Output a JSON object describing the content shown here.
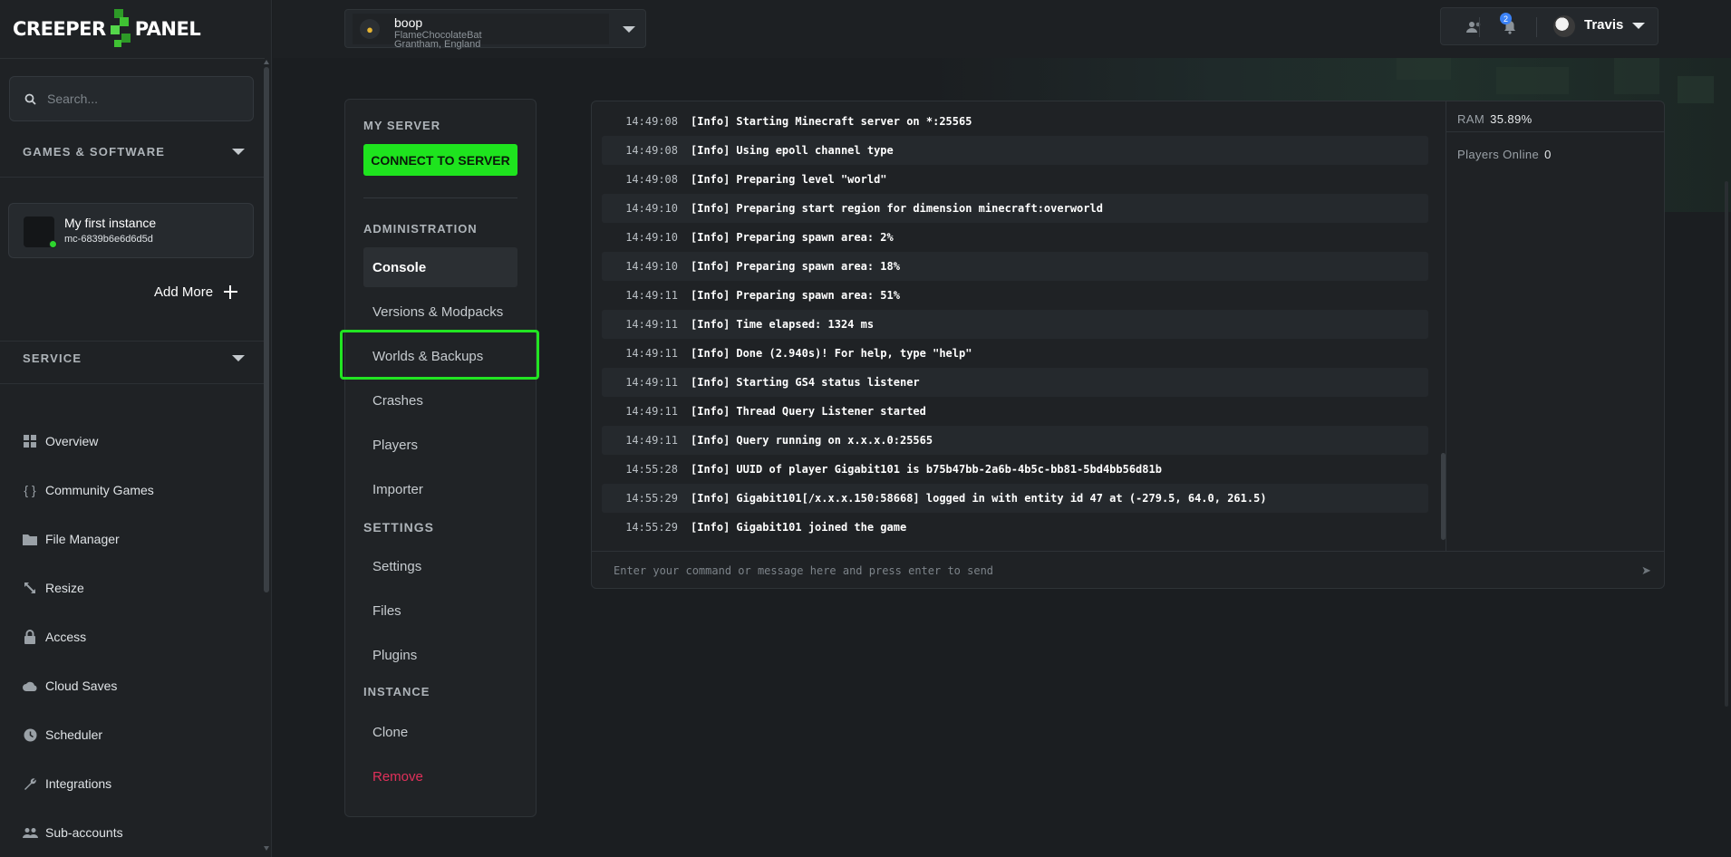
{
  "logo": {
    "left": "CREEPER",
    "right": "PANEL"
  },
  "sidebar": {
    "search_placeholder": "Search...",
    "games_section": "GAMES & SOFTWARE",
    "instance": {
      "name": "My first instance",
      "id": "mc-6839b6e6d6d5d"
    },
    "add_more": "Add More",
    "service_section": "SERVICE",
    "nav": [
      {
        "label": "Overview",
        "icon": "grid-icon"
      },
      {
        "label": "Community Games",
        "icon": "braces-icon"
      },
      {
        "label": "File Manager",
        "icon": "folder-icon"
      },
      {
        "label": "Resize",
        "icon": "resize-icon"
      },
      {
        "label": "Access",
        "icon": "lock-icon"
      },
      {
        "label": "Cloud Saves",
        "icon": "cloud-icon"
      },
      {
        "label": "Scheduler",
        "icon": "clock-icon"
      },
      {
        "label": "Integrations",
        "icon": "wrench-icon"
      },
      {
        "label": "Sub-accounts",
        "icon": "users-icon"
      }
    ]
  },
  "server": {
    "name": "boop",
    "host": "FlameChocolateBat",
    "location": "Grantham, England"
  },
  "user": {
    "name": "Travis",
    "notifications": "2"
  },
  "menu": {
    "my_server": "MY SERVER",
    "connect": "CONNECT TO SERVER",
    "administration": "ADMINISTRATION",
    "admin_items": [
      "Console",
      "Versions & Modpacks",
      "Worlds & Backups",
      "Crashes",
      "Players",
      "Importer"
    ],
    "settings": "SETTINGS",
    "settings_items": [
      "Settings",
      "Files",
      "Plugins"
    ],
    "instance": "INSTANCE",
    "instance_items": [
      "Clone",
      "Remove"
    ]
  },
  "console": {
    "logs": [
      {
        "time": "14:49:08",
        "level": "[Info]",
        "msg": "Starting Minecraft server on *:25565"
      },
      {
        "time": "14:49:08",
        "level": "[Info]",
        "msg": "Using epoll channel type"
      },
      {
        "time": "14:49:08",
        "level": "[Info]",
        "msg": "Preparing level \"world\""
      },
      {
        "time": "14:49:10",
        "level": "[Info]",
        "msg": "Preparing start region for dimension minecraft:overworld"
      },
      {
        "time": "14:49:10",
        "level": "[Info]",
        "msg": "Preparing spawn area: 2%"
      },
      {
        "time": "14:49:10",
        "level": "[Info]",
        "msg": "Preparing spawn area: 18%"
      },
      {
        "time": "14:49:11",
        "level": "[Info]",
        "msg": "Preparing spawn area: 51%"
      },
      {
        "time": "14:49:11",
        "level": "[Info]",
        "msg": "Time elapsed: 1324 ms"
      },
      {
        "time": "14:49:11",
        "level": "[Info]",
        "msg": "Done (2.940s)! For help, type \"help\""
      },
      {
        "time": "14:49:11",
        "level": "[Info]",
        "msg": "Starting GS4 status listener"
      },
      {
        "time": "14:49:11",
        "level": "[Info]",
        "msg": "Thread Query Listener started"
      },
      {
        "time": "14:49:11",
        "level": "[Info]",
        "msg": "Query running on x.x.x.0:25565"
      },
      {
        "time": "14:55:28",
        "level": "[Info]",
        "msg": "UUID of player Gigabit101 is b75b47bb-2a6b-4b5c-bb81-5bd4bb56d81b"
      },
      {
        "time": "14:55:29",
        "level": "[Info]",
        "msg": "Gigabit101[/x.x.x.150:58668] logged in with entity id 47 at (-279.5, 64.0, 261.5)"
      },
      {
        "time": "14:55:29",
        "level": "[Info]",
        "msg": "Gigabit101 joined the game"
      }
    ],
    "ram_label": "RAM",
    "ram_value": "35.89%",
    "players_label": "Players Online",
    "players_value": "0",
    "input_placeholder": "Enter your command or message here and press enter to send"
  },
  "colors": {
    "accent": "#1ee41e",
    "danger": "#e0305a",
    "badge": "#3b82f6"
  }
}
